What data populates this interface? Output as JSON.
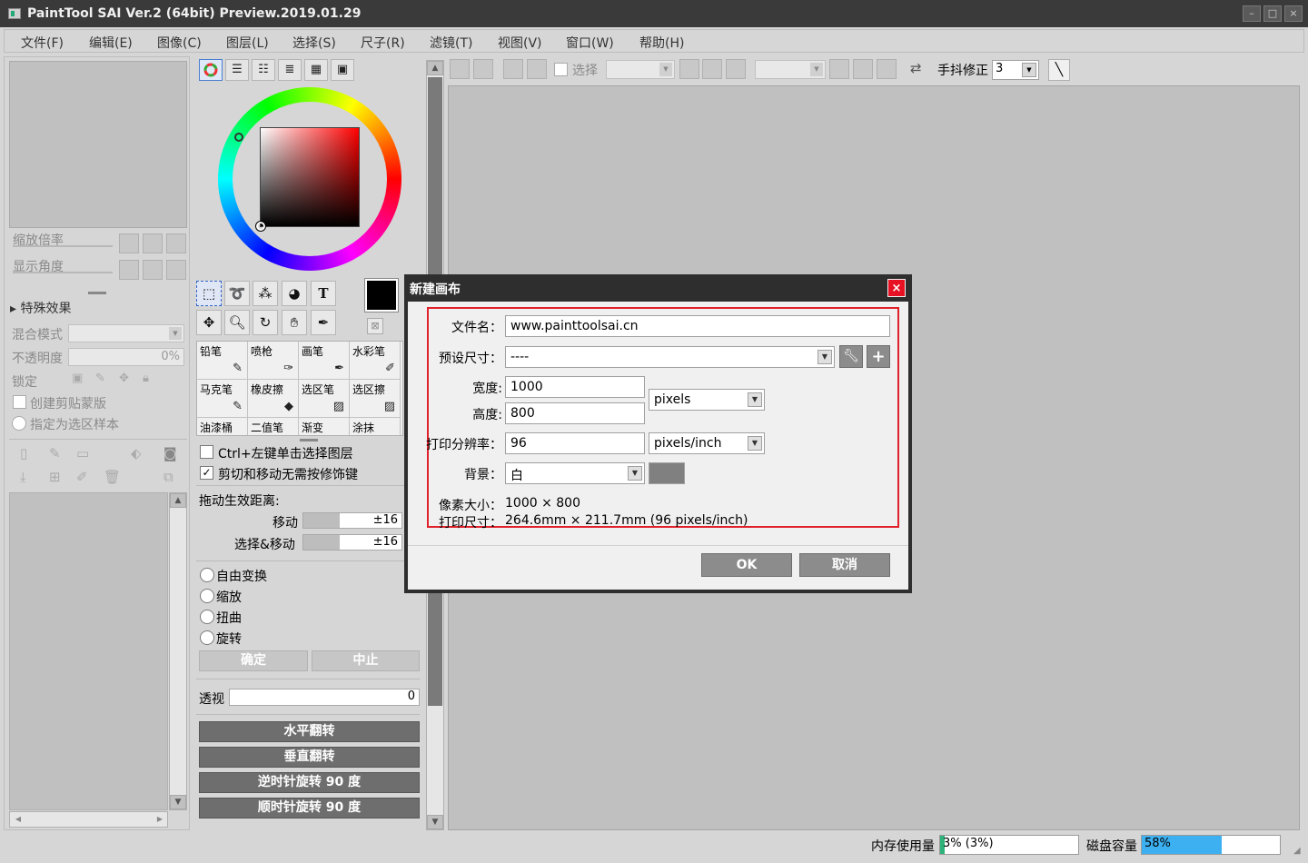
{
  "window": {
    "title": "PaintTool SAI Ver.2 (64bit) Preview.2019.01.29",
    "minimize": "–",
    "maximize": "□",
    "close": "×"
  },
  "menu": [
    "文件(F)",
    "编辑(E)",
    "图像(C)",
    "图层(L)",
    "选择(S)",
    "尺子(R)",
    "滤镜(T)",
    "视图(V)",
    "窗口(W)",
    "帮助(H)"
  ],
  "navigator": {
    "zoom_label": "缩放倍率",
    "angle_label": "显示角度"
  },
  "layer_panel": {
    "effects_label": "特殊效果",
    "blend_label": "混合模式",
    "opacity_label": "不透明度",
    "opacity_value": "0%",
    "lock_label": "锁定",
    "clip_label": "创建剪贴蒙版",
    "sample_label": "指定为选区样本"
  },
  "tools": {
    "text_tool": "T",
    "brushes": [
      {
        "label": "铅笔",
        "icon": "✎"
      },
      {
        "label": "喷枪",
        "icon": "✑"
      },
      {
        "label": "画笔",
        "icon": "✒"
      },
      {
        "label": "水彩笔",
        "icon": "✐"
      },
      {
        "label": "马克笔",
        "icon": "✎"
      },
      {
        "label": "橡皮擦",
        "icon": "◆"
      },
      {
        "label": "选区笔",
        "icon": "▨"
      },
      {
        "label": "选区擦",
        "icon": "▨"
      },
      {
        "label": "油漆桶",
        "icon": ""
      },
      {
        "label": "二值笔",
        "icon": ""
      },
      {
        "label": "渐变",
        "icon": ""
      },
      {
        "label": "涂抹",
        "icon": ""
      }
    ]
  },
  "tool_options": {
    "ctrl_click_label": "Ctrl+左键单击选择图层",
    "ctrl_click_checked": "",
    "cut_move_label": "剪切和移动无需按修饰键",
    "cut_move_checked": "✓",
    "drag_distance_label": "拖动生效距离:",
    "move_label": "移动",
    "move_value": "±16",
    "select_move_label": "选择&移动",
    "select_move_value": "±16",
    "free_transform": "自由变换",
    "scale": "缩放",
    "distort": "扭曲",
    "rotate": "旋转",
    "confirm": "确定",
    "abort": "中止",
    "perspective_label": "透视",
    "perspective_value": "0",
    "flip_h": "水平翻转",
    "flip_v": "垂直翻转",
    "rotate_ccw": "逆时针旋转 90 度",
    "rotate_cw": "顺时针旋转 90 度"
  },
  "canvas_toolbar": {
    "select_label": "选择",
    "stabilizer_label": "手抖修正",
    "stabilizer_value": "3"
  },
  "dialog": {
    "title": "新建画布",
    "filename_label": "文件名：",
    "filename_value": "www.painttoolsai.cn",
    "preset_label": "预设尺寸：",
    "preset_value": "----",
    "width_label": "宽度:",
    "width_value": "1000",
    "height_label": "高度:",
    "height_value": "800",
    "size_unit": "pixels",
    "dpi_label": "打印分辨率：",
    "dpi_value": "96",
    "dpi_unit": "pixels/inch",
    "bg_label": "背景：",
    "bg_value": "白",
    "pixel_size_label": "像素大小：",
    "pixel_size_value": "1000 × 800",
    "print_size_label": "打印尺寸：",
    "print_size_value": "264.6mm × 211.7mm (96 pixels/inch)",
    "ok": "OK",
    "cancel": "取消",
    "close": "×",
    "highlight_color": "#e0202a"
  },
  "status": {
    "memory_label": "内存使用量",
    "memory_value": "3% (3%)",
    "memory_fraction": 0.03,
    "disk_label": "磁盘容量",
    "disk_value": "58%",
    "disk_fraction": 0.58,
    "disk_color": "#3cb0f0",
    "memory_color": "#2db37a"
  },
  "colors": {
    "current_color": "#000000",
    "background_color": "#c0c0c0"
  }
}
